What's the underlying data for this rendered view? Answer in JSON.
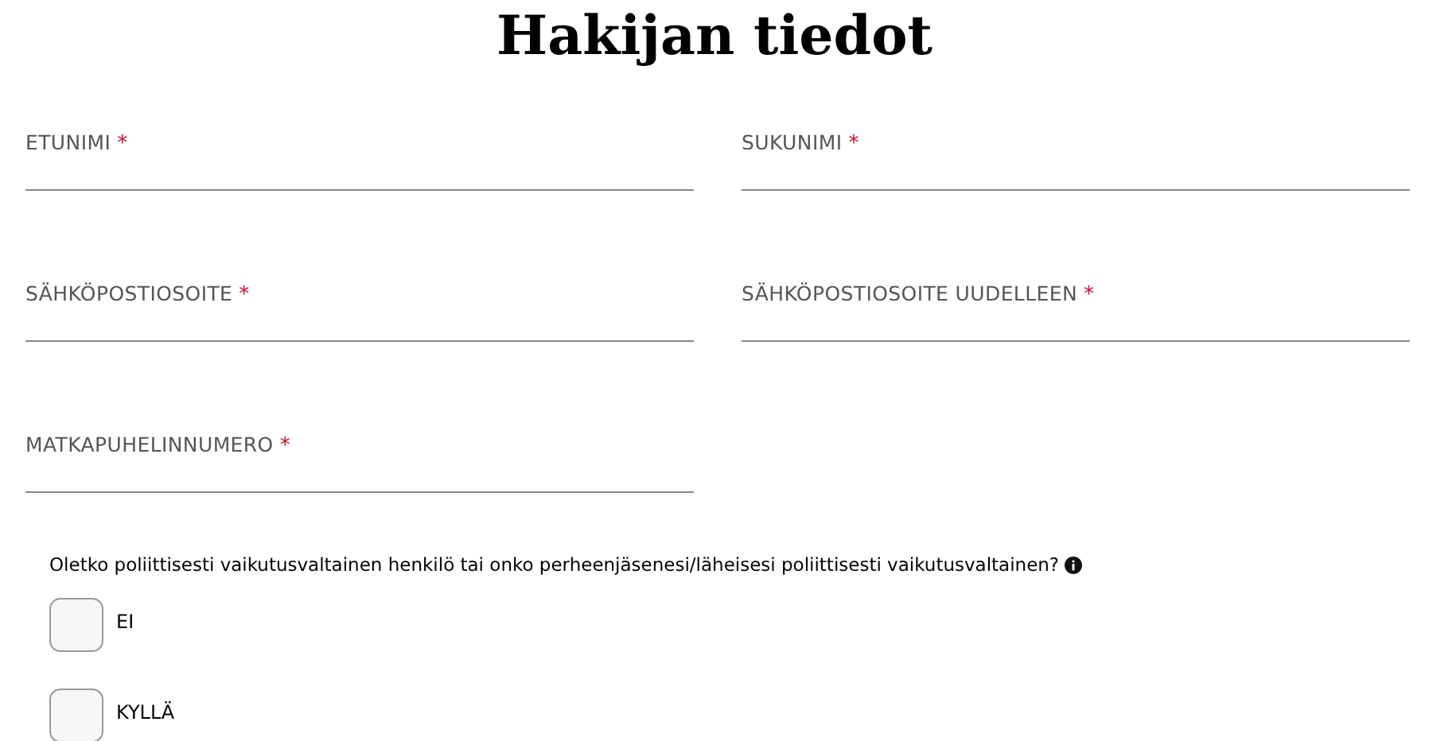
{
  "title": "Hakijan tiedot",
  "fields": [
    {
      "label": "ETUNIMI",
      "required_mark": "*"
    },
    {
      "label": "SUKUNIMI",
      "required_mark": "*"
    },
    {
      "label": "SÄHKÖPOSTIOSOITE",
      "required_mark": "*"
    },
    {
      "label": "SÄHKÖPOSTIOSOITE UUDELLEEN",
      "required_mark": "*"
    },
    {
      "label": "MATKAPUHELINNUMERO",
      "required_mark": "*"
    }
  ],
  "question": {
    "text": "Oletko poliittisesti vaikutusvaltainen henkilö tai onko perheenjäsenesi/läheisesi poliittisesti vaikutusvaltainen?",
    "options": [
      {
        "label": "EI",
        "checked": false
      },
      {
        "label": "KYLLÄ",
        "checked": false
      }
    ]
  }
}
